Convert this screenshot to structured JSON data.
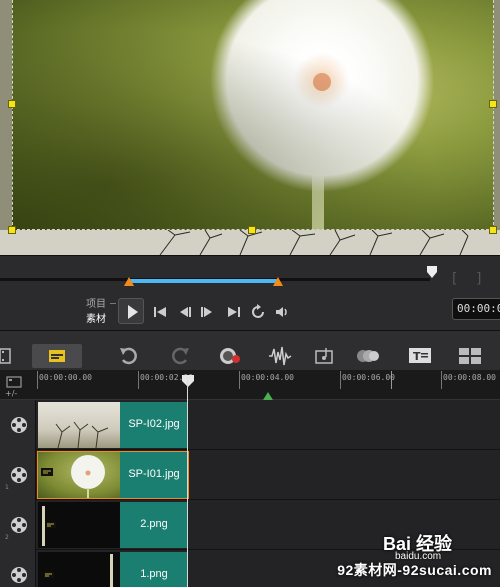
{
  "player": {
    "mode_project": "项目",
    "mode_clip": "素材",
    "timecode": "00:00:0"
  },
  "ruler": {
    "ticks": [
      "00:00:00.00",
      "00:00:02.00",
      "00:00:04.00",
      "00:00:06.00",
      "00:00:08.00"
    ]
  },
  "tracks": [
    {
      "label": "SP-I02.jpg",
      "selected": false
    },
    {
      "label": "SP-I01.jpg",
      "selected": true
    },
    {
      "label": "2.png",
      "selected": false
    },
    {
      "label": "1.png",
      "selected": false
    }
  ],
  "watermark": {
    "site": "92素材网-92sucai.com",
    "baidu": "Bai 经验",
    "baidu_url": "baidu.com"
  },
  "colors": {
    "clip_label_bg": "#1a7f70",
    "selection": "#f48a1c",
    "range_fill": "#4cb9f2",
    "handle": "#f4e41b"
  },
  "icons": {
    "toolbar": [
      "storyboard-toggle-icon",
      "undo-icon",
      "redo-icon",
      "record-capture-icon",
      "audio-mixer-icon",
      "auto-music-icon",
      "motion-track-icon",
      "subtitle-icon",
      "layout-grid-icon"
    ],
    "player": [
      "play-icon",
      "home-icon",
      "prev-frame-icon",
      "next-frame-icon",
      "end-icon",
      "repeat-icon",
      "volume-icon"
    ],
    "track": "film-reel-icon"
  }
}
